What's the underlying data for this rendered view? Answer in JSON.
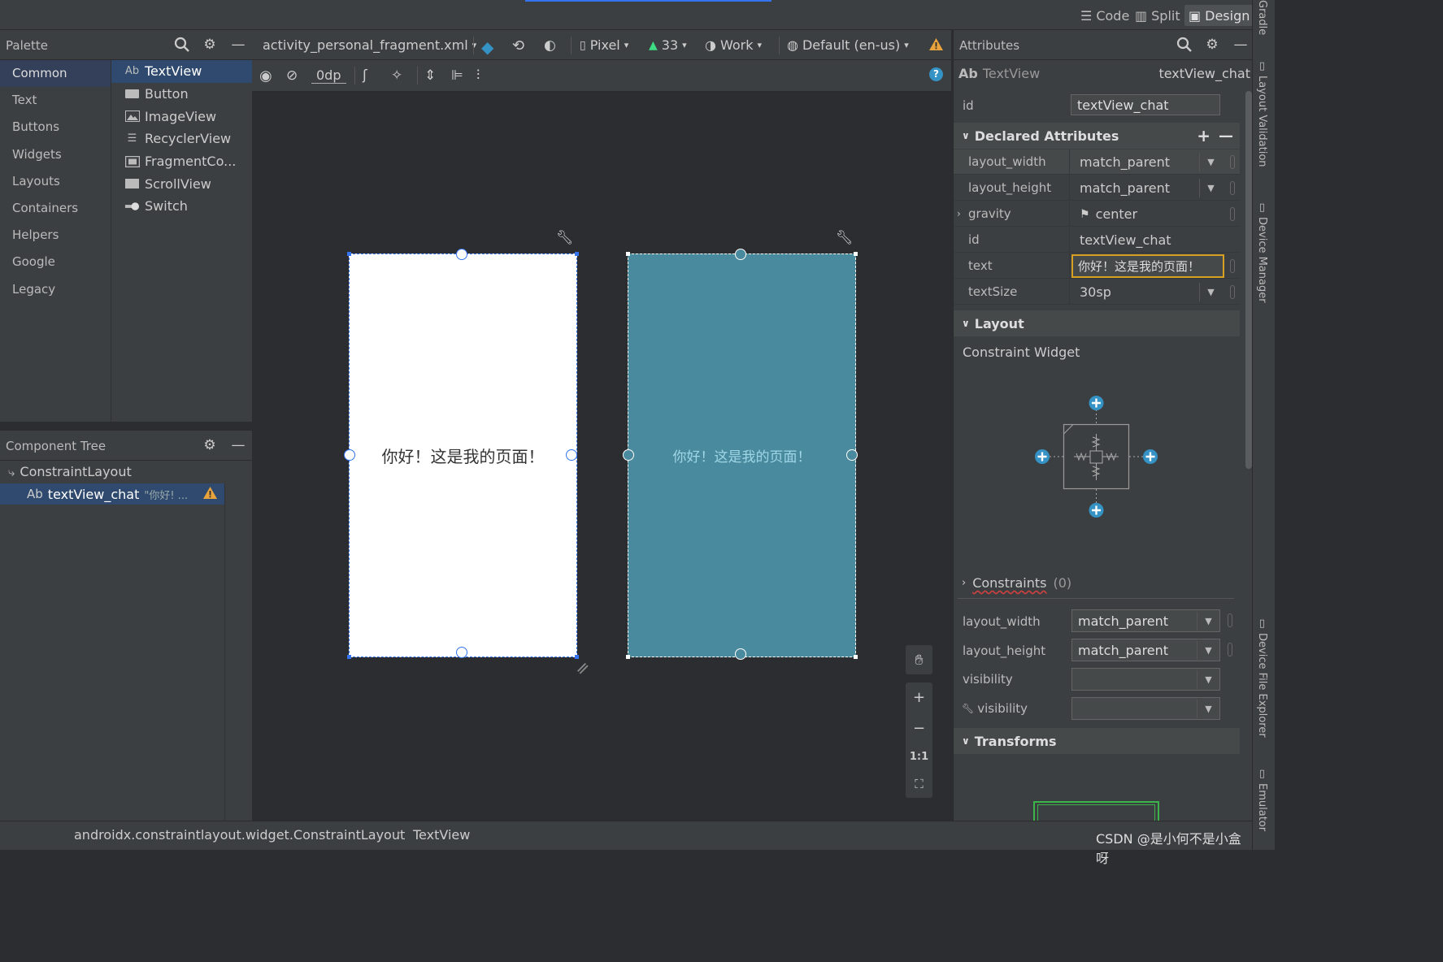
{
  "view_modes": [
    {
      "label": "Code",
      "icon": "code-icon"
    },
    {
      "label": "Split",
      "icon": "split-icon"
    },
    {
      "label": "Design",
      "icon": "design-icon",
      "active": true
    }
  ],
  "right_tabs": [
    "Gradle",
    "Layout Validation",
    "Device Manager",
    "Device File Explorer",
    "Emulator"
  ],
  "palette": {
    "title": "Palette",
    "categories": [
      "Common",
      "Text",
      "Buttons",
      "Widgets",
      "Layouts",
      "Containers",
      "Helpers",
      "Google",
      "Legacy"
    ],
    "items": [
      {
        "label": "TextView",
        "icon": "Ab"
      },
      {
        "label": "Button",
        "icon": "button-icon"
      },
      {
        "label": "ImageView",
        "icon": "image-icon"
      },
      {
        "label": "RecyclerView",
        "icon": "list-icon"
      },
      {
        "label": "FragmentCo...",
        "icon": "fragment-icon"
      },
      {
        "label": "ScrollView",
        "icon": "scroll-icon"
      },
      {
        "label": "Switch",
        "icon": "switch-icon"
      }
    ]
  },
  "component_tree": {
    "title": "Component Tree",
    "root": "ConstraintLayout",
    "child": {
      "icon": "Ab",
      "label": "textView_chat",
      "preview": "\"你好! ..."
    }
  },
  "editor": {
    "file": "activity_personal_fragment.xml",
    "device": "Pixel",
    "api": "33",
    "theme": "Work",
    "locale": "Default (en-us)",
    "margin": "0dp"
  },
  "canvas": {
    "design_text": "你好！这是我的页面！",
    "blueprint_text": "你好！这是我的页面！",
    "zoom_ratio": "1:1"
  },
  "attributes": {
    "title": "Attributes",
    "widget_type_icon": "Ab",
    "widget_type": "TextView",
    "widget_id": "textView_chat",
    "id_label": "id",
    "id_value": "textView_chat",
    "declared_title": "Declared Attributes",
    "declared": [
      {
        "name": "layout_width",
        "value": "match_parent",
        "dropdown": true
      },
      {
        "name": "layout_height",
        "value": "match_parent",
        "dropdown": true
      },
      {
        "name": "gravity",
        "value": "center",
        "flag": true
      },
      {
        "name": "id",
        "value": "textView_chat"
      },
      {
        "name": "text",
        "value": "你好！这是我的页面！",
        "focused": true
      },
      {
        "name": "textSize",
        "value": "30sp",
        "dropdown": true
      }
    ],
    "layout_title": "Layout",
    "constraint_widget": "Constraint Widget",
    "constraints_label": "Constraints",
    "constraints_count": "(0)",
    "layout_fields": [
      {
        "name": "layout_width",
        "value": "match_parent"
      },
      {
        "name": "layout_height",
        "value": "match_parent"
      },
      {
        "name": "visibility",
        "value": ""
      },
      {
        "name": "visibility",
        "value": "",
        "tool": true
      }
    ],
    "transforms_title": "Transforms"
  },
  "breadcrumb": [
    "androidx.constraintlayout.widget.ConstraintLayout",
    "TextView"
  ],
  "watermark": "CSDN @是小何不是小盒呀",
  "colors": {
    "blueprint": "#4a8a9e",
    "accent": "#3574f0",
    "focus": "#d6a021",
    "plus": "#3592c4"
  }
}
